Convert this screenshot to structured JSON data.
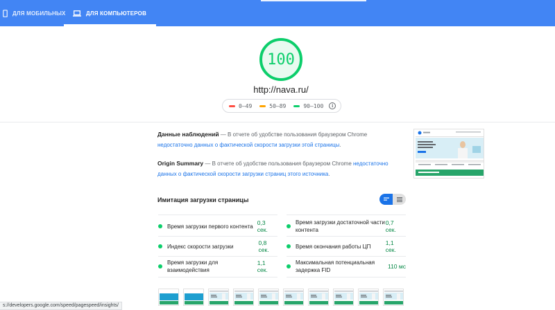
{
  "tabs": {
    "mobile": "ДЛЯ МОБИЛЬНЫХ",
    "desktop": "ДЛЯ КОМПЬЮТЕРОВ"
  },
  "score": {
    "value": "100",
    "fraction": 1.0,
    "color": "#0cce6b"
  },
  "url": "http://nava.ru/",
  "legend": {
    "ranges": [
      {
        "label": "0–49",
        "color": "#ff4e42"
      },
      {
        "label": "50–89",
        "color": "#ffa400"
      },
      {
        "label": "90–100",
        "color": "#0cce6b"
      }
    ],
    "info_icon": "info-icon"
  },
  "field_data": {
    "title": "Данные наблюдений",
    "dash": " — В отчете об удобстве пользования браузером Chrome ",
    "link": "недостаточно данных о фактической скорости загрузки этой страницы",
    "end": "."
  },
  "origin_summary": {
    "title": "Origin Summary",
    "dash": " — В отчете об удобстве пользования браузером Chrome ",
    "link": "недостаточно данных о фактической скорости загрузки страниц этого источника",
    "end": "."
  },
  "lab": {
    "title": "Имитация загрузки страницы",
    "metrics_left": [
      {
        "label": "Время загрузки первого контента",
        "value": "0,3 сек."
      },
      {
        "label": "Индекс скорости загрузки",
        "value": "0,8 сек."
      },
      {
        "label": "Время загрузки для взаимодействия",
        "value": "1,1 сек."
      }
    ],
    "metrics_right": [
      {
        "label": "Время загрузки достаточной части контента",
        "value": "0,7 сек."
      },
      {
        "label": "Время окончания работы ЦП",
        "value": "1,1 сек."
      },
      {
        "label": "Максимальная потенциальная задержка FID",
        "value": "110 мс"
      }
    ]
  },
  "status_bar": "s://developers.google.com/speed/pagespeed/insights/"
}
